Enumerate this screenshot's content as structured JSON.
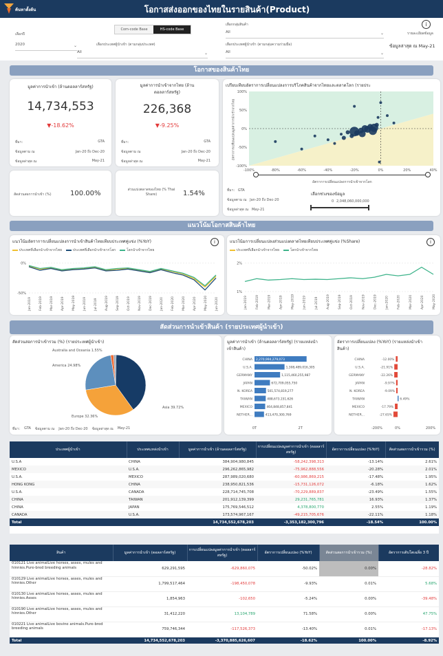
{
  "header": {
    "logo_text": "ค้นหาตั้งต้น",
    "title": "โอกาสส่งออกของไทยในรายสินค้า(Product)"
  },
  "filters": {
    "year_label": "เลือกปี",
    "year_value": "2020",
    "toggle_com": "Com-code Base",
    "toggle_hs": "HS-code Base",
    "group_label": "เลือกกลุ่มสินค้า",
    "group_value": "All",
    "importer_label": "เลือกประเทศผู้นำเข้า (ตามกลุ่มประเทศ)",
    "importer_value": "All",
    "importer2_label": "เลือกประเทศผู้นำเข้า (ตามกลุ่มความร่วมมือ)",
    "importer2_value": "All",
    "detail_label": "รายละเอียดข้อมูล",
    "latest": "ข้อมูลล่าสุด ณ May-21",
    "info": "i"
  },
  "section1": "โอกาสของสินค้าไทย",
  "kpi1": {
    "title": "มูลค่าการนำเข้า (ล้านดอลลาร์สหรัฐ)",
    "value": "14,734,553",
    "change": "▼-18.62%",
    "src_l": "ที่มา:",
    "src": "GTA",
    "per_l": "ข้อมูลตาม ณ",
    "per": "Jan-20 ถึง Dec-20",
    "upd_l": "ข้อมูลล่าสุด ณ",
    "upd": "May-21"
  },
  "kpi2": {
    "title": "มูลค่าการนำเข้าจากไทย (ล้านดอลลาร์สหรัฐ)",
    "value": "226,368",
    "change": "▼-9.25%",
    "src_l": "ที่มา:",
    "src": "GTA",
    "per_l": "ข้อมูลตาม ณ",
    "per": "Jan-20 ถึง Dec-20",
    "upd_l": "ข้อมูลล่าสุด ณ",
    "upd": "May-21"
  },
  "kpi3": {
    "label": "สัดส่วนสอการนำเข้า (%)",
    "value": "100.00%"
  },
  "kpi4": {
    "label": "ส่วนแบ่งตลาดของไทย (% Thai Share)",
    "value": "1.54%"
  },
  "scatter": {
    "title": "เปรียบเทียบอัตราการเปลี่ยนแปลงการบริโภคสินค้าจากไทยและตลาดโลก (รายประ",
    "ylabel": "อัตราการเปลี่ยนแปลงมูลค่าการนำเข้าจากไทย",
    "xlabel": "อัตราการเปลี่ยนแปลงการนำเข้าจากโลก",
    "src_l": "ที่มา:",
    "src": "GTA",
    "per_l": "ข้อมูลตาม ณ",
    "per": "Jan-20 ถึง Dec-20",
    "upd_l": "ข้อมูลล่าสุด ณ",
    "upd": "May-21",
    "range_label": "เลือกช่วงของข้อมูล",
    "range_min": "0",
    "range_max": "2,048,060,000,000"
  },
  "section2": "แนวโน้มโอกาสสินค้าไทย",
  "trend1": {
    "title": "แนวโน้มอัตราการเปลี่ยนแปลงการนำเข้าสินค้าไทยเทียบประเทศคู่แข่ง (%YoY)",
    "legend": [
      "ประเทศที่เลือกนำเข้าจากไทย",
      "ประเทศที่เลือกนำเข้าจากโลก",
      "โลกนำเข้าจากไทย"
    ]
  },
  "trend2": {
    "title": "แนวโน้มการเปลี่ยนแปลงส่วนแบ่งตลาดไทยเทียบประเทศคู่แข่ง (%Share)",
    "legend": [
      "ประเทศที่เลือกนำเข้าจากไทย",
      "โลกนำเข้าจากไทย"
    ]
  },
  "months1": [
    "Jan-2019",
    "Feb-2019",
    "Mar-2019",
    "Apr-2019",
    "May-2019",
    "Jun-2019",
    "Jul-2019",
    "Aug-2019",
    "Sep-2019",
    "Oct-2019",
    "Nov-2019",
    "Dec-2019",
    "Jan-2020",
    "Feb-2020",
    "Mar-2020",
    "Apr-2020",
    "May-2020",
    "Jun-2020"
  ],
  "months2": [
    "Jan-2019",
    "Feb-2019",
    "Mar-2019",
    "Apr-2019",
    "May-2019",
    "Jun-2019",
    "Jul-2019",
    "Aug-2019",
    "Sep-2019",
    "Oct-2019",
    "Nov-2019",
    "Dec-2019",
    "Jan-2020",
    "Feb-2020",
    "Mar-2020",
    "Apr-2020",
    "May-2020"
  ],
  "section3": "สัดส่วนการนำเข้าสินค้า (รายประเทศผู้นำเข้า)",
  "pie": {
    "title": "สัดส่วนสอการนำเข้ารวม (%) (รายประเทศผู้นำเข้า)",
    "labels": [
      "Asia 39.72%",
      "America 24.98%",
      "Europe 32.36%",
      "Australia and Oceania 1.55%"
    ],
    "src_l": "ที่มา:",
    "src": "GTA",
    "per_l": "ข้อมูลตาม ณ",
    "per": "Jan-20 ถึง Dec-20",
    "upd_l": "ข้อมูลล่าสุด ณ",
    "upd": "May-21"
  },
  "bars": {
    "title": "มูลค่าการนำเข้า (ล้านดอลลาร์สหรัฐ) (รายแหล่งนำเข้าสินค้า)",
    "axis": [
      "0T",
      "2T"
    ]
  },
  "yoybars": {
    "title": "อัตราการเปลี่ยนแปลง (%YoY) (รายแหล่งนำเข้าสินค้า)",
    "axis": [
      "-200%",
      "0%",
      "200%"
    ]
  },
  "chart_data": [
    {
      "type": "pie",
      "title": "สัดส่วนสอการนำเข้ารวม (%) (รายประเทศผู้นำเข้า)",
      "categories": [
        "Asia",
        "America",
        "Europe",
        "Australia and Oceania",
        "Other"
      ],
      "values": [
        39.72,
        24.98,
        32.36,
        1.55,
        1.39
      ],
      "colors": [
        "#163b66",
        "#5d8fbd",
        "#f5a23a",
        "#ee6a33",
        "#9aa7b6"
      ]
    },
    {
      "type": "bar",
      "title": "มูลค่าการนำเข้า (ล้านดอลลาร์สหรัฐ) (รายแหล่งนำเข้าสินค้า)",
      "categories": [
        "CHINA",
        "U.S.A.",
        "GERMANY",
        "JAPAN",
        "N. KOREA",
        "TAIWAN",
        "MEXICO",
        "NETHER..."
      ],
      "values": [
        2270994279073,
        1308489016305,
        1115460255987,
        672709055750,
        501574819277,
        488673151626,
        464848857841,
        413470300769
      ],
      "labels": [
        "2,270,994,279,073",
        "1,308,489,016,305",
        "1,115,460,255,987",
        "672,709,055,750",
        "501,574,819,277",
        "488,673,151,626",
        "464,848,857,841",
        "413,470,300,769"
      ],
      "xlim": [
        0,
        3000000000000
      ]
    },
    {
      "type": "bar",
      "title": "อัตราการเปลี่ยนแปลง (%YoY) (รายแหล่งนำเข้าสินค้า)",
      "categories": [
        "CHINA",
        "U.S.A.",
        "GERMANY",
        "JAPAN",
        "N. KOREA",
        "TAIWAN",
        "MEXICO",
        "NETHER..."
      ],
      "values": [
        -12.0,
        -21.91,
        -22.26,
        -9.97,
        -9.09,
        6.49,
        -17.79,
        -27.65
      ],
      "labels": [
        "-12.00%",
        "-21.91%",
        "-22.26%",
        "-9.97%",
        "-9.09%",
        "6.49%",
        "-17.79%",
        "-27.65%"
      ],
      "xlim": [
        -200,
        200
      ]
    },
    {
      "type": "line",
      "title": "แนวโน้มอัตราการเปลี่ยนแปลงการนำเข้าสินค้าไทยเทียบประเทศคู่แข่ง (%YoY)",
      "x": [
        "Jan-2019",
        "Feb-2019",
        "Mar-2019",
        "Apr-2019",
        "May-2019",
        "Jun-2019",
        "Jul-2019",
        "Aug-2019",
        "Sep-2019",
        "Oct-2019",
        "Nov-2019",
        "Dec-2019",
        "Jan-2020",
        "Feb-2020",
        "Mar-2020",
        "Apr-2020",
        "May-2020",
        "Jun-2020"
      ],
      "series": [
        {
          "name": "ประเทศที่เลือกนำเข้าจากไทย",
          "values": [
            -5,
            -10,
            -8,
            -12,
            -10,
            -9,
            -7,
            -12,
            -10,
            -9,
            -12,
            -15,
            -10,
            -14,
            -18,
            -26,
            -40,
            -22
          ],
          "color": "#f0c030"
        },
        {
          "name": "ประเทศที่เลือกนำเข้าจากโลก",
          "values": [
            -6,
            -12,
            -9,
            -13,
            -11,
            -10,
            -8,
            -13,
            -12,
            -10,
            -13,
            -16,
            -11,
            -16,
            -20,
            -28,
            -45,
            -25
          ],
          "color": "#1f4e79"
        },
        {
          "name": "โลกนำเข้าจากไทย",
          "values": [
            -4,
            -9,
            -7,
            -11,
            -9,
            -8,
            -6,
            -11,
            -9,
            -8,
            -11,
            -14,
            -9,
            -13,
            -17,
            -24,
            -38,
            -20
          ],
          "color": "#3db38a"
        }
      ],
      "ylim": [
        -50,
        10
      ]
    },
    {
      "type": "line",
      "title": "แนวโน้มการเปลี่ยนแปลงส่วนแบ่งตลาดไทยเทียบประเทศคู่แข่ง (%Share)",
      "x": [
        "Jan-2019",
        "Feb-2019",
        "Mar-2019",
        "Apr-2019",
        "May-2019",
        "Jun-2019",
        "Jul-2019",
        "Aug-2019",
        "Sep-2019",
        "Oct-2019",
        "Nov-2019",
        "Dec-2019",
        "Jan-2020",
        "Feb-2020",
        "Mar-2020",
        "Apr-2020",
        "May-2020"
      ],
      "series": [
        {
          "name": "โลกนำเข้าจากไทย",
          "values": [
            1.35,
            1.45,
            1.4,
            1.42,
            1.45,
            1.42,
            1.43,
            1.42,
            1.45,
            1.48,
            1.45,
            1.5,
            1.6,
            1.55,
            1.6,
            1.85,
            1.6
          ],
          "color": "#3db38a"
        }
      ],
      "ylim": [
        1,
        2.2
      ]
    },
    {
      "type": "scatter",
      "title": "เปรียบเทียบอัตราการเปลี่ยนแปลงการบริโภคสินค้าจากไทยและตลาดโลก",
      "xlim": [
        -100,
        40
      ],
      "ylim": [
        -100,
        100
      ],
      "points": [
        [
          -5,
          2,
          6
        ],
        [
          -10,
          -2,
          5
        ],
        [
          -15,
          -5,
          4
        ],
        [
          -20,
          -8,
          7
        ],
        [
          -8,
          5,
          4
        ],
        [
          -3,
          10,
          3
        ],
        [
          -12,
          0,
          5
        ],
        [
          -18,
          -12,
          4
        ],
        [
          -25,
          -10,
          3
        ],
        [
          -22,
          -20,
          3
        ],
        [
          -30,
          -15,
          2
        ],
        [
          -2,
          30,
          2
        ],
        [
          5,
          35,
          2
        ],
        [
          -40,
          -30,
          2
        ],
        [
          -35,
          -40,
          2
        ],
        [
          -60,
          -55,
          2
        ],
        [
          -80,
          -35,
          2
        ],
        [
          0,
          70,
          2
        ],
        [
          -1,
          -90,
          2
        ],
        [
          -20,
          60,
          2
        ],
        [
          10,
          15,
          2
        ],
        [
          -50,
          -20,
          2
        ],
        [
          -28,
          -25,
          3
        ],
        [
          -6,
          -6,
          6
        ],
        [
          -14,
          -14,
          5
        ]
      ]
    }
  ],
  "table1": {
    "headers": [
      "ประเทศผู้นำเข้า",
      "ประเทศแหล่งนำเข้า",
      "มูลค่าการนำเข้า (ล้านดอลลาร์สหรัฐ)",
      "การเปลี่ยนแปลงมูลค่าการนำเข้า (ดอลลาร์สหรัฐ)",
      "อัตราการเปลี่ยนแปลง (%YoY)",
      "สัดส่วนสอการนำเข้ารวม (%)"
    ],
    "rows": [
      [
        "U.S.A",
        "CHINA",
        "384,904,980,845",
        "-58,242,398,313",
        "-13.14%",
        "2.61%"
      ],
      [
        "MEXICO",
        "U.S.A.",
        "296,262,865,982",
        "-75,962,888,556",
        "-20.28%",
        "2.01%"
      ],
      [
        "U.S.A.",
        "MEXICO",
        "287,989,020,680",
        "-60,986,869,215",
        "-17.48%",
        "1.95%"
      ],
      [
        "HONG KONG",
        "CHINA",
        "238,950,821,536",
        "-15,731,126,072",
        "-6.18%",
        "1.62%"
      ],
      [
        "U.S.A.",
        "CANADA",
        "228,714,745,708",
        "-70,229,889,837",
        "-23.49%",
        "1.55%"
      ],
      [
        "CHINA",
        "TAIWAN",
        "201,912,139,399",
        "29,231,765,781",
        "16.93%",
        "1.37%"
      ],
      [
        "CHINA",
        "JAPAN",
        "175,769,546,512",
        "4,378,800,770",
        "2.55%",
        "1.19%"
      ],
      [
        "CANADA",
        "U.S.A.",
        "173,574,967,167",
        "-49,215,705,676",
        "-22.11%",
        "1.18%"
      ]
    ],
    "total": [
      "Total",
      "",
      "14,734,552,678,203",
      "-3,353,182,300,796",
      "-18.54%",
      "100.00%"
    ]
  },
  "table2": {
    "headers": [
      "สินค้า",
      "มูลค่าการนำเข้า (ดอลลาร์สหรัฐ)",
      "การเปลี่ยนแปลงมูลค่าการนำเข้า (ดอลลาร์สหรัฐ)",
      "อัตราการเปลี่ยนแปลง (%YoY)",
      "สัดส่วนสอการนำเข้ารวม (%)",
      "อัตราการเติบโตเฉลี่ย 3 ปี"
    ],
    "rows": [
      [
        "010121 Live animalLive horses, asses, mules and hinnies.Pure-bred breeding animals",
        "629,291,595",
        "-629,860,075",
        "-50.02%",
        "0.00%",
        "-28.82%"
      ],
      [
        "010129 Live animalLive horses, asses, mules and hinnies.Other",
        "1,799,517,464",
        "-198,450,078",
        "-9.93%",
        "0.01%",
        "5.68%"
      ],
      [
        "010130 Live animalLive horses, asses, mules and hinnies.Asses",
        "1,854,963",
        "-102,650",
        "-5.24%",
        "0.00%",
        "-39.48%"
      ],
      [
        "010190 Live animalLive horses, asses, mules and hinnies.Other",
        "31,412,220",
        "13,104,789",
        "71.58%",
        "0.00%",
        "47.75%"
      ],
      [
        "010221 Live animalLive bovine animals.Pure-bred breeding animals",
        "759,746,344",
        "-117,526,373",
        "-13.40%",
        "0.01%",
        "-17.13%"
      ]
    ],
    "total": [
      "Total",
      "14,734,552,678,203",
      "-3,370,885,626,607",
      "-18.62%",
      "100.00%",
      "-8.92%"
    ]
  }
}
